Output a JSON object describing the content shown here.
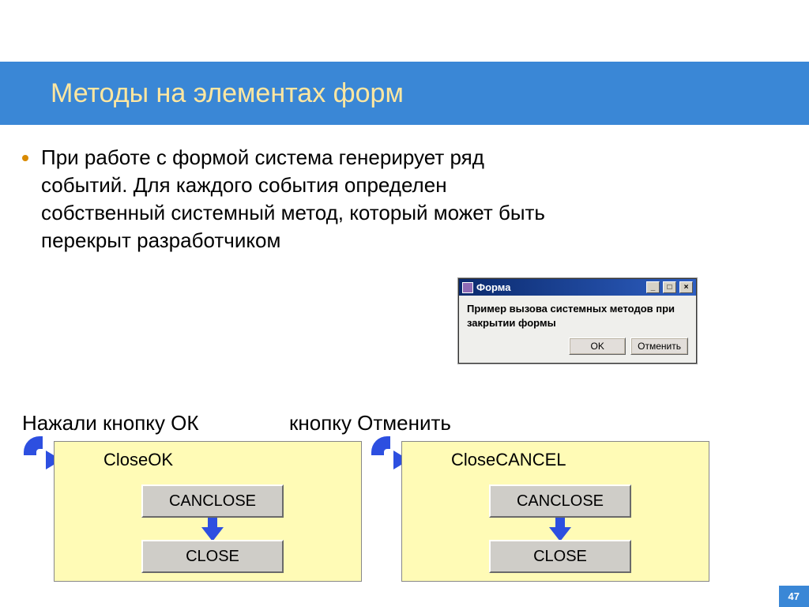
{
  "slide": {
    "title": "Методы на элементах форм",
    "bullet": "При работе с формой система генерирует ряд событий. Для каждого события определен собственный системный метод, который может быть перекрыт разработчиком",
    "number": "47"
  },
  "dialog": {
    "title": "Форма",
    "body": "Пример вызова системных методов при закрытии формы",
    "ok": "OK",
    "cancel": "Отменить",
    "min_glyph": "_",
    "max_glyph": "□",
    "close_glyph": "×"
  },
  "labels": {
    "ok_pressed": "Нажали кнопку ОК",
    "cancel_pressed": "кнопку Отменить"
  },
  "flow_ok": {
    "start": "CloseOK",
    "step1": "CANCLOSE",
    "step2": "CLOSE"
  },
  "flow_cancel": {
    "start": "CloseCANCEL",
    "step1": "CANCLOSE",
    "step2": "CLOSE"
  }
}
